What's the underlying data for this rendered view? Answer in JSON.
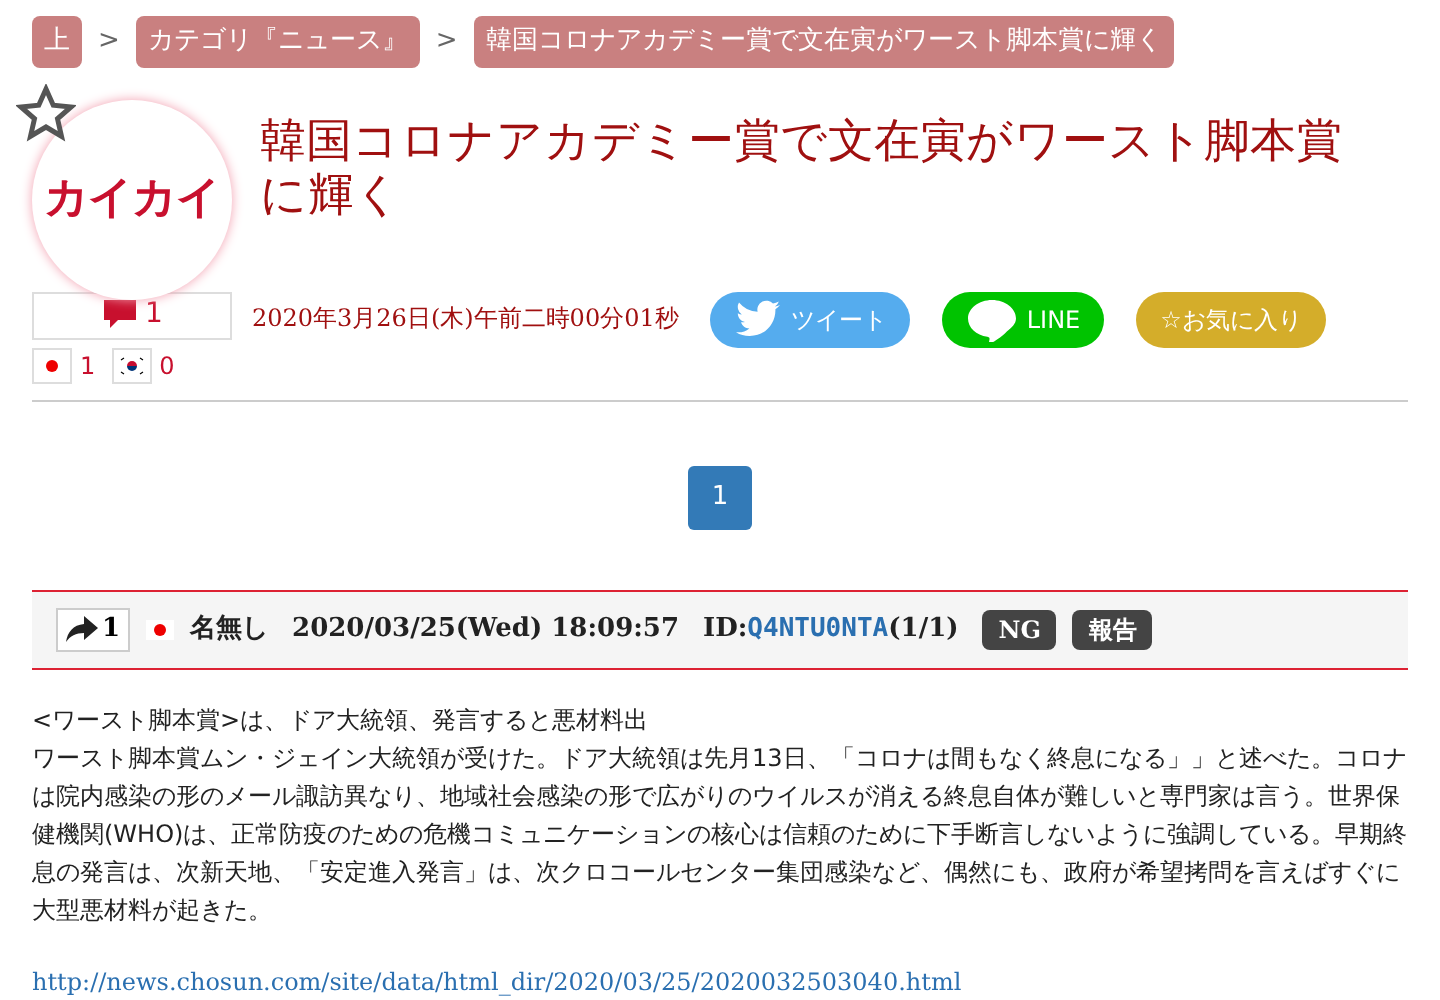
{
  "breadcrumb": [
    {
      "label": "上"
    },
    {
      "label": "カテゴリ『ニュース』"
    },
    {
      "label": "韓国コロナアカデミー賞で文在寅がワースト脚本賞に輝く"
    }
  ],
  "breadcrumb_separator": ">",
  "article": {
    "favorited": false,
    "logo_text": "カイカイ",
    "title": "韓国コロナアカデミー賞で文在寅がワースト脚本賞に輝く",
    "comment_count": "1",
    "votes": [
      {
        "kind": "japan",
        "count": "1"
      },
      {
        "kind": "korea",
        "count": "0"
      }
    ],
    "date": "2020年3月26日(木)午前二時00分01秒",
    "share_buttons": [
      {
        "kind": "twitter",
        "label": "ツイート"
      },
      {
        "kind": "line",
        "label": "LINE"
      },
      {
        "kind": "favorite",
        "label": "☆お気に入り"
      }
    ]
  },
  "pagination": [
    {
      "label": "1",
      "selected": true
    }
  ],
  "post": {
    "reply_count": "1",
    "flag": {
      "kind": "japan"
    },
    "name": "名無し",
    "datetime": "2020/03/25(Wed) 18:09:57",
    "id_label": "ID:",
    "id": "Q4NTU0NTA",
    "id_count": "(1/1)",
    "buttons": [
      "NG",
      "報告"
    ],
    "body": [
      "<ワースト脚本賞>は、ドア大統領、発言すると悪材料出",
      "ワースト脚本賞ムン・ジェイン大統領が受けた。ドア大統領は先月13日、「コロナは間もなく終息になる」」と述べた。コロナは院内感染の形のメール諏訪異なり、地域社会感染の形で広がりのウイルスが消える終息自体が難しいと専門家は言う。世界保健機関(WHO)は、正常防疫のための危機コミュニケーションの核心は信頼のために下手断言しないように強調している。早期終息の発言は、次新天地、「安定進入発言」は、次クロコールセンター集団感染など、偶然にも、政府が希望拷問を言えばすぐに大型悪材料が起きた。"
    ],
    "link": "http://news.chosun.com/site/data/html_dir/2020/03/25/2020032503040.html"
  }
}
